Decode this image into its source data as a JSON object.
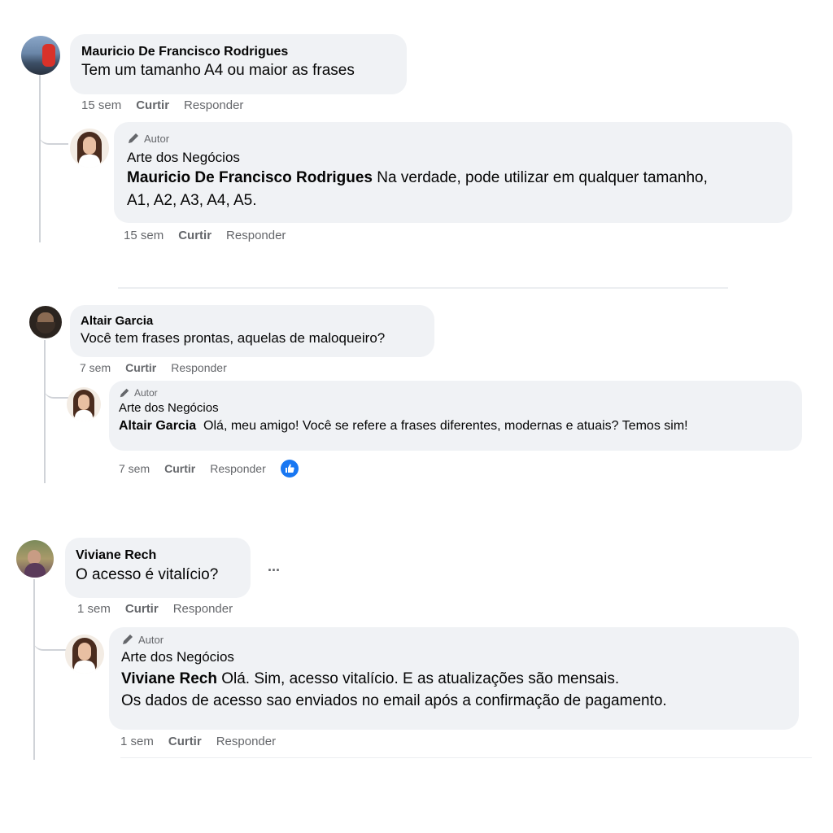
{
  "threads": [
    {
      "comment": {
        "author": "Mauricio De Francisco Rodrigues",
        "text": "Tem um tamanho A4 ou maior as frases",
        "time": "15 sem",
        "like": "Curtir",
        "reply": "Responder"
      },
      "reply": {
        "badge": "Autor",
        "author": "Arte dos Negócios",
        "mention": "Mauricio De Francisco Rodrigues",
        "text_line1": " Na verdade, pode utilizar em qualquer tamanho,",
        "text_line2": "A1, A2, A3, A4, A5.",
        "time": "15 sem",
        "like": "Curtir",
        "reply": "Responder"
      }
    },
    {
      "comment": {
        "author": "Altair Garcia",
        "text": "Você tem frases prontas, aquelas de maloqueiro?",
        "time": "7 sem",
        "like": "Curtir",
        "reply": "Responder"
      },
      "reply": {
        "badge": "Autor",
        "author": "Arte dos Negócios",
        "mention": "Altair Garcia",
        "text_line1": "  Olá, meu amigo! Você se refere a frases diferentes, modernas e atuais? Temos sim!",
        "time": "7 sem",
        "like": "Curtir",
        "reply": "Responder",
        "reaction": "like"
      }
    },
    {
      "comment": {
        "author": "Viviane Rech",
        "text": "O acesso é vitalício?",
        "more": "...",
        "time": "1 sem",
        "like": "Curtir",
        "reply": "Responder"
      },
      "reply": {
        "badge": "Autor",
        "author": "Arte dos Negócios",
        "mention": "Viviane Rech",
        "text_line1": " Olá. Sim, acesso vitalício. E as atualizações são mensais.",
        "text_line2": "Os dados de acesso sao enviados no email após a confirmação de pagamento.",
        "time": "1 sem",
        "like": "Curtir",
        "reply": "Responder"
      }
    }
  ],
  "colors": {
    "bubble": "#f0f2f5",
    "meta_text": "#65676b",
    "like_reaction": "#1877f2"
  }
}
